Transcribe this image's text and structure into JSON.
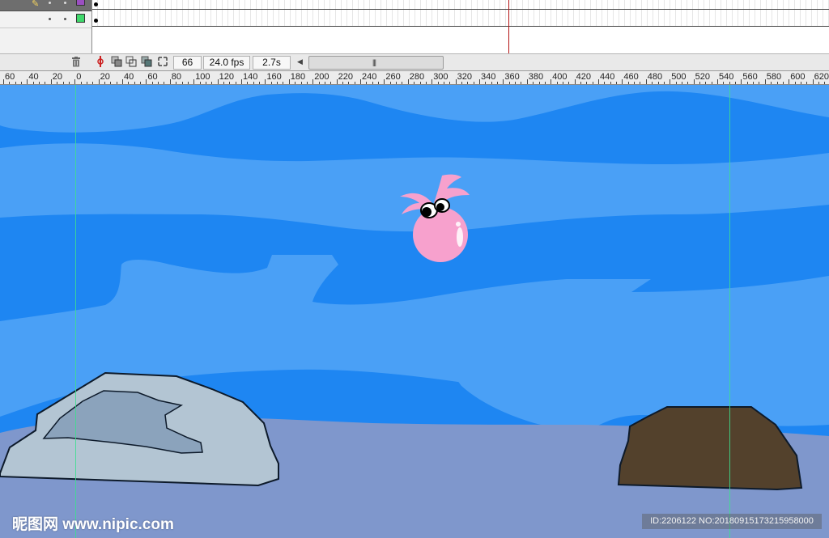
{
  "timeline": {
    "layers": [
      {
        "swatch_color": "#9b4fc1"
      },
      {
        "swatch_color": "#3fd86b"
      }
    ],
    "status": {
      "current_frame": "66",
      "frame_rate": "24.0 fps",
      "elapsed_time": "2.7s"
    }
  },
  "ruler": {
    "labels": [
      "60",
      "40",
      "20",
      "0",
      "20",
      "40",
      "60",
      "80",
      "100",
      "120",
      "140",
      "160",
      "180",
      "200",
      "220",
      "240",
      "260",
      "280",
      "300",
      "320",
      "340",
      "360",
      "380",
      "400",
      "420",
      "440",
      "460",
      "480",
      "500",
      "520",
      "540",
      "560",
      "580",
      "600",
      "620"
    ]
  },
  "stage": {
    "colors": {
      "water_deep": "#1e86f2",
      "water_light": "#4aa0f6",
      "sea_floor": "#7f97cc",
      "light_rock": "#b3c5d3",
      "light_rock_shadow": "#8ba3bc",
      "dark_rock": "#53412c",
      "octopus_pink": "#f7a1cd"
    }
  },
  "watermarks": {
    "left_text": "昵图网 www.nipic.com",
    "right_text": "ID:2206122 NO:20180915173215958000"
  }
}
